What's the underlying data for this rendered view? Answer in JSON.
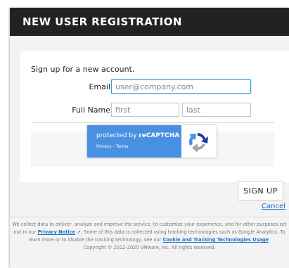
{
  "dialog": {
    "title": "NEW USER REGISTRATION"
  },
  "form": {
    "intro": "Sign up for a new account.",
    "email": {
      "label": "Email",
      "placeholder": "user@company.com"
    },
    "full_name": {
      "label": "Full Name",
      "first_placeholder": "first",
      "last_placeholder": "last"
    }
  },
  "captcha": {
    "protected_by": "protected by ",
    "brand": "reCAPTCHA",
    "privacy": "Privacy",
    "separator": " - ",
    "terms": "Terms",
    "logo_icon": "recaptcha-logo-icon"
  },
  "actions": {
    "sign_up": "SIGN UP",
    "cancel": "Cancel"
  },
  "footer": {
    "text1": "We collect data to deliver, analyze and improve the service, to customize your experience, and for other purposes set out in our ",
    "privacy_link": "Privacy Notice",
    "external_icon": "external-link-icon",
    "text2": ". Some of this data is collected using tracking technologies such as Google Analytics. To learn more or to disable the tracking technology, see our ",
    "cookie_link": "Cookie and Tracking Technologies Usage",
    "text3": ".",
    "copyright": "Copyright © 2012-2020 VMware, Inc. All rights reserved."
  },
  "colors": {
    "header_bg": "#222222",
    "link": "#1a73c8",
    "captcha_blue": "#4a90e2",
    "focus_border": "#3a9ad9"
  }
}
